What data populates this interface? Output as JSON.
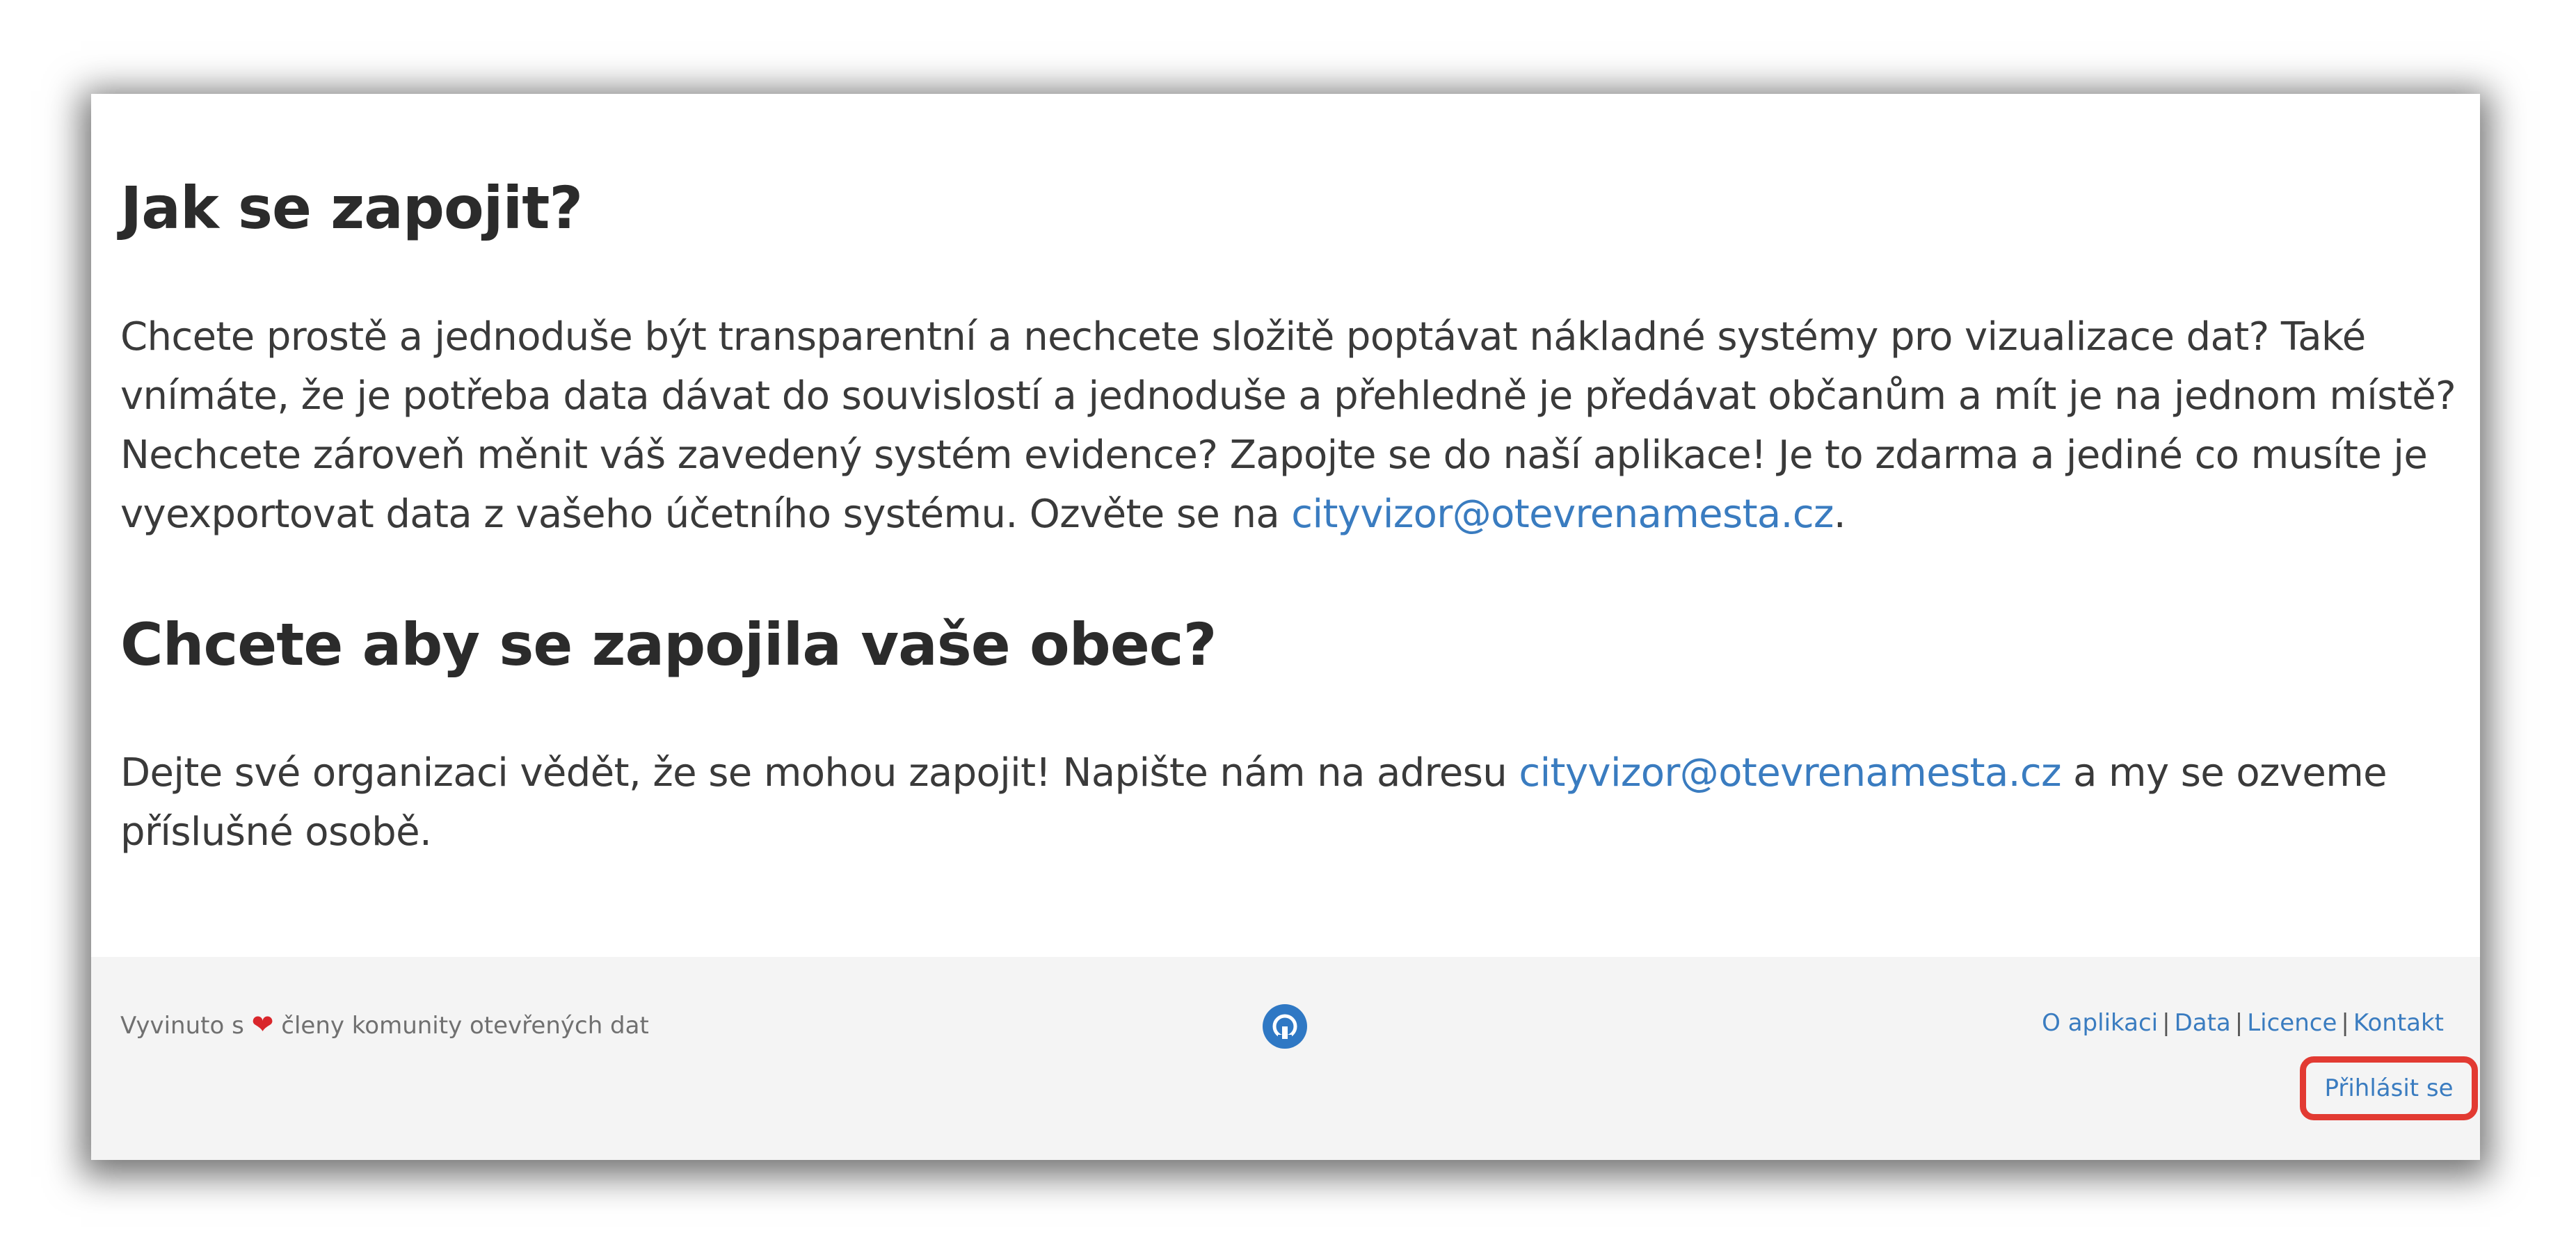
{
  "main": {
    "section_join": {
      "heading": "Jak se zapojit?",
      "text_before_email": "Chcete prostě a jednoduše být transparentní a nechcete složitě poptávat nákladné systémy pro vizualizace dat? Také vnímáte, že je potřeba data dávat do souvislostí a jednoduše a přehledně je předávat občanům a mít je na jednom místě? Nechcete zároveň měnit váš zavedený systém evidence? Zapojte se do naší aplikace! Je to zdarma a jediné co musíte je vyexportovat data z vašeho účetního systému. Ozvěte se na ",
      "email": "cityvizor@otevrenamesta.cz",
      "text_after_email": "."
    },
    "section_city": {
      "heading": "Chcete aby se zapojila vaše obec?",
      "text_before_email": "Dejte své organizaci vědět, že se mohou zapojit! Napište nám na adresu ",
      "email": "cityvizor@otevrenamesta.cz",
      "text_after_email": " a my se ozveme příslušné osobě."
    }
  },
  "footer": {
    "credits_prefix": "Vyvinuto s",
    "heart_glyph": "❤",
    "credits_suffix": "členy komunity otevřených dat",
    "github_icon": "github-icon",
    "links": [
      "O aplikaci",
      "Data",
      "Licence",
      "Kontakt"
    ],
    "separator": "|",
    "login_label": "Přihlásit se"
  },
  "colors": {
    "link": "#3a7cc0",
    "heart": "#d9262b",
    "highlight": "#e23a32",
    "footer_bg": "#f4f4f4",
    "github_bg": "#2f78c4"
  }
}
